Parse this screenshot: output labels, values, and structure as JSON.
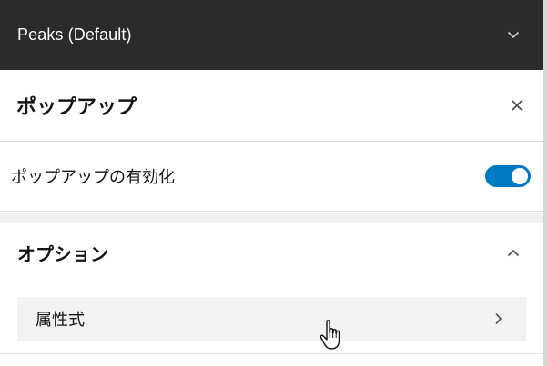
{
  "layer_header": {
    "title": "Peaks (Default)",
    "icon": "chevron-down-icon"
  },
  "panel": {
    "title": "ポップアップ",
    "close_icon": "close-icon"
  },
  "enable_row": {
    "label": "ポップアップの有効化",
    "enabled": true
  },
  "options_section": {
    "title": "オプション",
    "expanded": true,
    "icon": "chevron-up-icon",
    "items": [
      {
        "label": "属性式",
        "icon": "chevron-right-icon"
      }
    ]
  },
  "colors": {
    "header_bg": "#2b2b2b",
    "toggle_on": "#007ac2",
    "item_bg": "#f2f2f2"
  },
  "cursor": "hand-pointer-icon"
}
